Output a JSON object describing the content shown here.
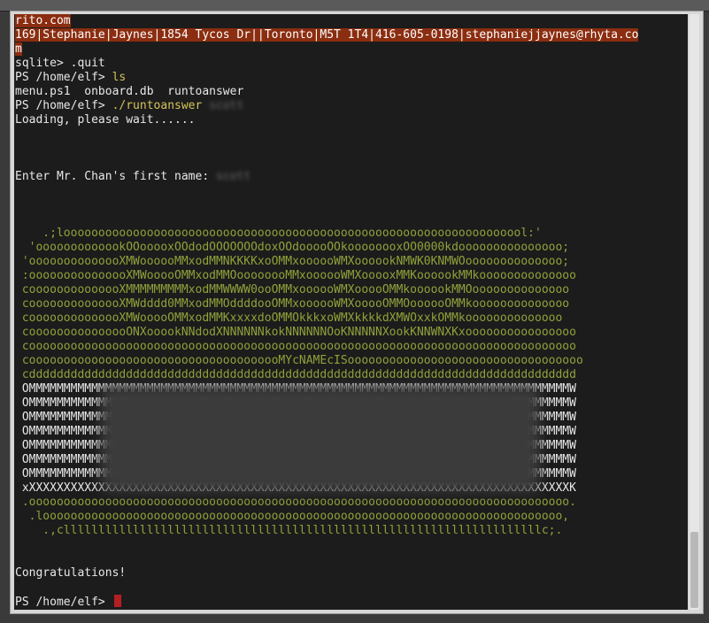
{
  "terminal": {
    "lines": [
      {
        "text": "rito.com",
        "style": "hl"
      },
      {
        "text": "169|Stephanie|Jaynes|1854 Tycos Dr||Toronto|M5T 1T4|416-605-0198|stephaniejjaynes@rhyta.co",
        "style": "hl"
      },
      {
        "text": "m",
        "style": "hl"
      },
      {
        "text": "sqlite> .quit",
        "style": "plain"
      },
      {
        "text": "PS /home/elf> ",
        "cmd": "ls",
        "style": "prompt"
      },
      {
        "text": "menu.ps1  onboard.db  runtoanswer",
        "style": "plain"
      },
      {
        "text": "PS /home/elf> ",
        "cmd": "./runtoanswer",
        "extra": " scott",
        "style": "prompt"
      },
      {
        "text": "Loading, please wait......",
        "style": "plain"
      },
      {
        "text": "",
        "style": "plain"
      },
      {
        "text": "",
        "style": "plain"
      },
      {
        "text": "",
        "style": "plain"
      },
      {
        "text": "Enter Mr. Chan's first name: ",
        "extra": "scott",
        "style": "input"
      },
      {
        "text": "",
        "style": "plain"
      },
      {
        "text": "",
        "style": "plain"
      },
      {
        "text": "",
        "style": "plain"
      },
      {
        "text": "    .;looooooooooooooooooooooooooooooooooooooooooooooooooooooooooooooooool:'",
        "style": "art"
      },
      {
        "text": "  'ooooooooooookOOooooxOOdodOOOOOOOdoxOOdooooOOkoooooooxOO0000kdooooooooooooooo;",
        "style": "art"
      },
      {
        "text": " 'oooooooooooooXMWoooooMMxodMMNKKKKxoOMMxoooooWMXoooookNMWK0KNMWOoooooooooooooo;",
        "style": "art"
      },
      {
        "text": " :ooooooooooooooXMWooooOMMxodMMOoooooooMMxoooooWMXooooxMMKoooookMMkoooooooooooooo",
        "style": "art"
      },
      {
        "text": " coooooooooooooXMMMMMMMMMxodMMWWWW0ooOMMxoooooWMXooooOMMkoooookMMOoooooooooooooo",
        "style": "art"
      },
      {
        "text": " coooooooooooooXMWdddd0MMxodMMOddddooOMMxoooooWMXooooOMMOoooooOMMkoooooooooooooo",
        "style": "art"
      },
      {
        "text": " coooooooooooooXMWooooOMMxodMMKxxxxdoOMMOkkkxoWMXkkkkdXMWOxxkOMMkoooooooooooooo",
        "style": "art"
      },
      {
        "text": " cooooooooooooooONXooookNNdodXNNNNNNkokNNNNNNOoKNNNNNXookKNNWNXKxoooooooooooooooo",
        "style": "art"
      },
      {
        "text": " cooooooooooooooooooooooooooooooooooooooooooooooooooooooooooooooooooooooooooooooo",
        "style": "art"
      },
      {
        "text": " cooooooooooooooooooooooooooooooooooooMYcNAMEcISoooooooooooooooooooooooooooooooooo",
        "style": "art"
      },
      {
        "text": " cddddddddddddddddddddddddddddddddddddddddddddddddddddddddddddddddddddddddddddddd",
        "style": "art"
      },
      {
        "text": " OMMMMMMMMMMMMMMMMMMMMMMMMMMMMMMMMMMMMMMMMMMMMMMMMMMMMMMMMMMMMMMMMMMMMMMMMMMMMMMW",
        "style": "artw"
      },
      {
        "text": " OMMMMMMMMMMMMMMMMMMMMMMMMMMMMMMMMMMMMMMMMMMMMMMMMMMMMMMMMMMMMMMMMMMMMMMMMMMMMMMW",
        "style": "artw"
      },
      {
        "text": " OMMMMMMMMMMMMMMMMMMMMMMMMMMMMMMMMMMMMMMMMMMMMMMMMMMMMMMMMMMMMMMMMMMMMMMMMMMMMMMW",
        "style": "artw"
      },
      {
        "text": " OMMMMMMMMMMMMMMMMMMMMMMMMMMMMMMMMMMMMMMMMMMMMMMMMMMMMMMMMMMMMMMMMMMMMMMMMMMMMMMW",
        "style": "artw"
      },
      {
        "text": " OMMMMMMMMMMMMMMMMMMMMMMMMMMMMMMMMMMMMMMMMMMMMMMMMMMMMMMMMMMMMMMMMMMMMMMMMMMMMMMW",
        "style": "artw"
      },
      {
        "text": " OMMMMMMMMMMMMMMMMMMMMMMMMMMMMMMMMMMMMMMMMMMMMMMMMMMMMMMMMMMMMMMMMMMMMMMMMMMMMMMW",
        "style": "artw"
      },
      {
        "text": " OMMMMMMMMMMMMMMMMMMMMMMMMMMMMMMMMMMMMMMMMMMMMMMMMMMMMMMMMMMMMMMMMMMMMMMMMMMMMMMW",
        "style": "artw"
      },
      {
        "text": " xXXXXXXXXXXXXXXXXXXXXXXXXXXXXXXXXXXXXXXXXXXXXXXXXXXXXXXXXXXXXXXXXXXXXXXXXXXXXXXK",
        "style": "artw"
      },
      {
        "text": " .oooooooooooooooooooooooooooooooooooooooooooooooooooooooooooooooooooooooooooooo.",
        "style": "art"
      },
      {
        "text": "  .looooooooooooooooooooooooooooooooooooooooooooooooooooooooooooooooooooooooooo,",
        "style": "art"
      },
      {
        "text": "    .,clllllllllllllllllllllllllllllllllllllllllllllllllllllllllllllllllllllc;.",
        "style": "art"
      },
      {
        "text": "",
        "style": "plain"
      },
      {
        "text": "",
        "style": "plain"
      },
      {
        "text": "Congratulations!",
        "style": "plain"
      },
      {
        "text": "",
        "style": "plain"
      },
      {
        "text": "PS /home/elf> ",
        "style": "final"
      }
    ]
  },
  "colors": {
    "background": "#1c1c1c",
    "text": "#e8e8e8",
    "command": "#d6c35a",
    "highlight": "#8b2d10",
    "art": "#8fa23a",
    "cursor": "#b51e24"
  }
}
